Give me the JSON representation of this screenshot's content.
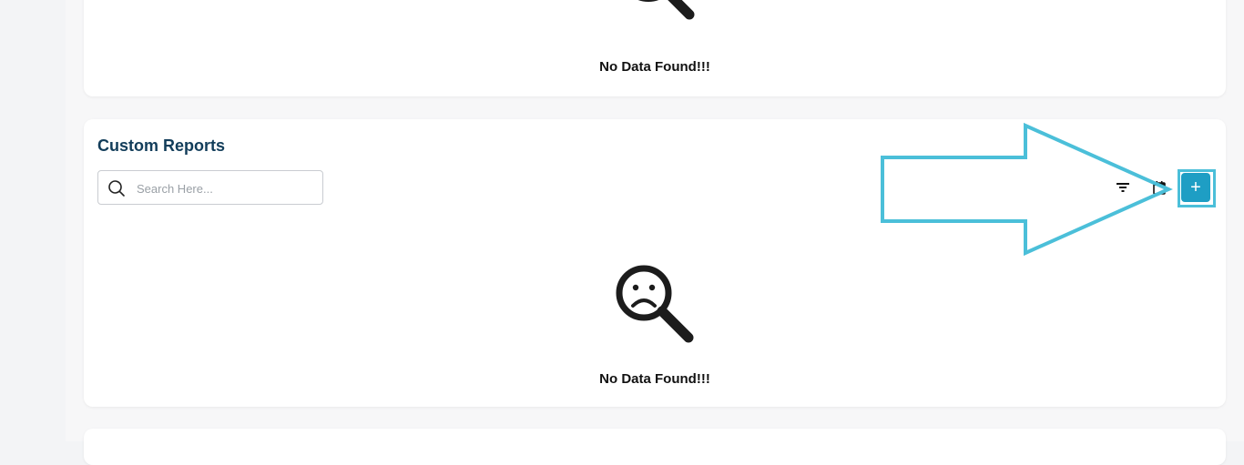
{
  "top_card": {
    "empty_text": "No Data Found!!!"
  },
  "custom_reports": {
    "title": "Custom Reports",
    "search": {
      "placeholder": "Search Here...",
      "value": ""
    },
    "add_label": "+",
    "empty_text": "No Data Found!!!"
  },
  "colors": {
    "accent": "#1e9ec4",
    "title": "#123d5a",
    "highlight": "#4bbfd9"
  },
  "icons": {
    "search": "search-icon",
    "filter": "filter-icon",
    "calendar": "calendar-icon",
    "empty": "sad-magnifier-icon",
    "annotation": "arrow-annotation"
  }
}
